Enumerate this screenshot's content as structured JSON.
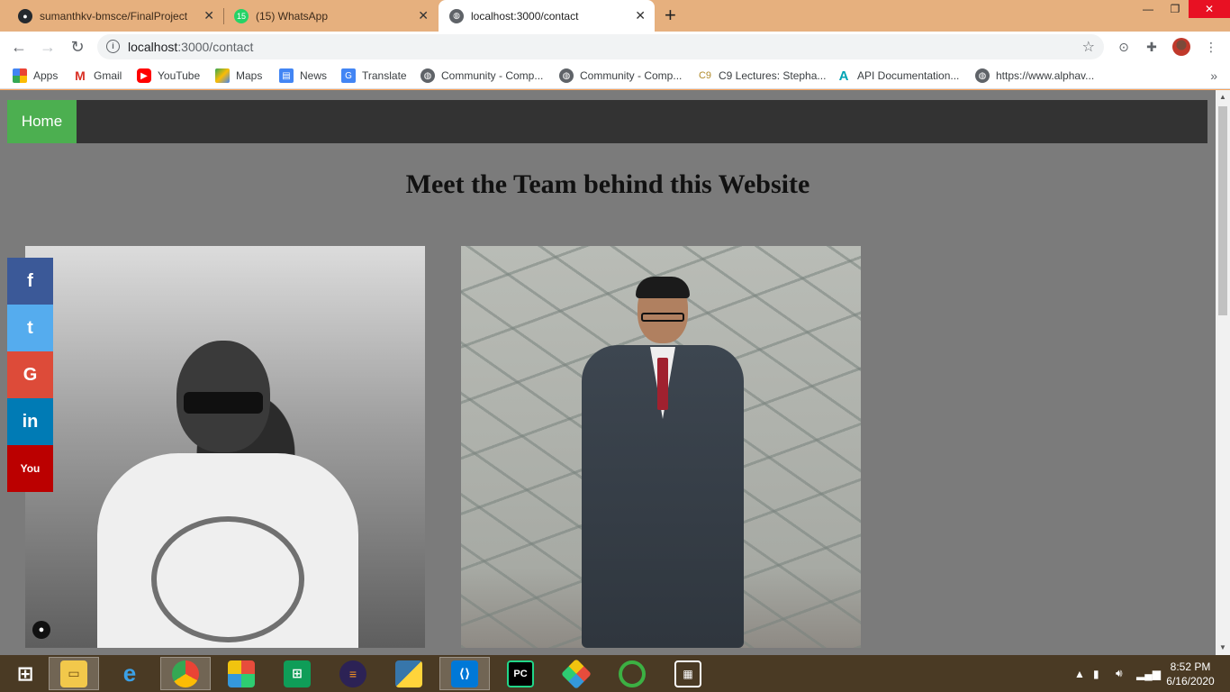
{
  "tabs": [
    {
      "title": "sumanthkv-bmsce/FinalProject",
      "icon": "github-icon"
    },
    {
      "title": "(15) WhatsApp",
      "icon": "whatsapp-icon",
      "badge": "15"
    },
    {
      "title": "localhost:3000/contact",
      "icon": "globe-icon",
      "active": true
    }
  ],
  "address": {
    "url_host": "localhost",
    "url_rest": ":3000/contact"
  },
  "bookmarks": [
    {
      "label": "Apps",
      "icon": "apps-grid-icon"
    },
    {
      "label": "Gmail",
      "icon": "gmail-icon"
    },
    {
      "label": "YouTube",
      "icon": "youtube-icon"
    },
    {
      "label": "Maps",
      "icon": "maps-icon"
    },
    {
      "label": "News",
      "icon": "news-icon"
    },
    {
      "label": "Translate",
      "icon": "translate-icon"
    },
    {
      "label": "Community - Comp...",
      "icon": "globe-icon"
    },
    {
      "label": "Community - Comp...",
      "icon": "globe-icon"
    },
    {
      "label": "C9 Lectures: Stepha...",
      "icon": "c9-icon"
    },
    {
      "label": "API Documentation...",
      "icon": "api-icon"
    },
    {
      "label": "https://www.alphav...",
      "icon": "globe-icon"
    }
  ],
  "page": {
    "nav": {
      "home_label": "Home"
    },
    "title": "Meet the Team behind this Website",
    "social": [
      {
        "name": "facebook",
        "glyph": "f",
        "color": "#3b5998"
      },
      {
        "name": "twitter",
        "glyph": "t",
        "color": "#55acee"
      },
      {
        "name": "google",
        "glyph": "G",
        "color": "#dd4b39"
      },
      {
        "name": "linkedin",
        "glyph": "in",
        "color": "#007bb5"
      },
      {
        "name": "youtube",
        "glyph": "You",
        "color": "#bb0000"
      }
    ]
  },
  "taskbar": {
    "apps": [
      "start-icon",
      "file-explorer-icon",
      "internet-explorer-icon",
      "chrome-icon",
      "office-icon",
      "store-icon",
      "eclipse-icon",
      "python-icon",
      "vscode-icon",
      "pycharm-icon",
      "git-icon",
      "refresh-app-icon",
      "calculator-icon"
    ],
    "time": "8:52 PM",
    "date": "6/16/2020"
  },
  "colors": {
    "nav_bg": "#333333",
    "home_bg": "#4caf50",
    "page_bg": "#7b7b7b",
    "title_bar": "#e6b07e"
  }
}
